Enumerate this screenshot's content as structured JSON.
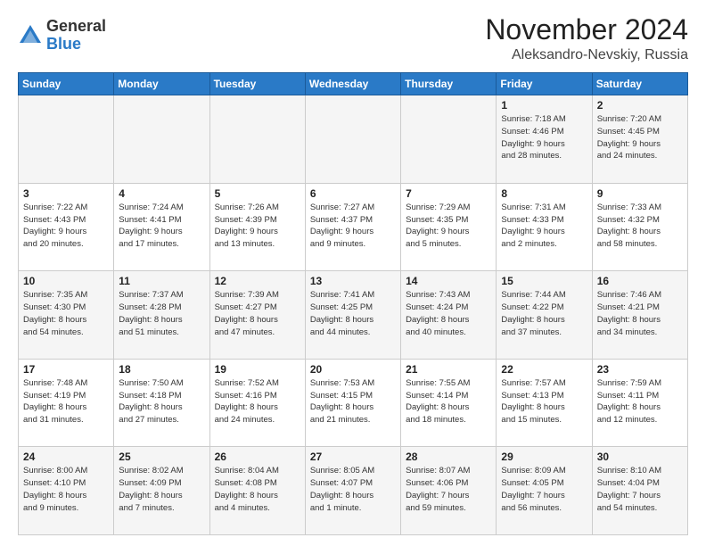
{
  "logo": {
    "general": "General",
    "blue": "Blue"
  },
  "title": "November 2024",
  "location": "Aleksandro-Nevskiy, Russia",
  "days_header": [
    "Sunday",
    "Monday",
    "Tuesday",
    "Wednesday",
    "Thursday",
    "Friday",
    "Saturday"
  ],
  "weeks": [
    [
      {
        "day": "",
        "info": ""
      },
      {
        "day": "",
        "info": ""
      },
      {
        "day": "",
        "info": ""
      },
      {
        "day": "",
        "info": ""
      },
      {
        "day": "",
        "info": ""
      },
      {
        "day": "1",
        "info": "Sunrise: 7:18 AM\nSunset: 4:46 PM\nDaylight: 9 hours\nand 28 minutes."
      },
      {
        "day": "2",
        "info": "Sunrise: 7:20 AM\nSunset: 4:45 PM\nDaylight: 9 hours\nand 24 minutes."
      }
    ],
    [
      {
        "day": "3",
        "info": "Sunrise: 7:22 AM\nSunset: 4:43 PM\nDaylight: 9 hours\nand 20 minutes."
      },
      {
        "day": "4",
        "info": "Sunrise: 7:24 AM\nSunset: 4:41 PM\nDaylight: 9 hours\nand 17 minutes."
      },
      {
        "day": "5",
        "info": "Sunrise: 7:26 AM\nSunset: 4:39 PM\nDaylight: 9 hours\nand 13 minutes."
      },
      {
        "day": "6",
        "info": "Sunrise: 7:27 AM\nSunset: 4:37 PM\nDaylight: 9 hours\nand 9 minutes."
      },
      {
        "day": "7",
        "info": "Sunrise: 7:29 AM\nSunset: 4:35 PM\nDaylight: 9 hours\nand 5 minutes."
      },
      {
        "day": "8",
        "info": "Sunrise: 7:31 AM\nSunset: 4:33 PM\nDaylight: 9 hours\nand 2 minutes."
      },
      {
        "day": "9",
        "info": "Sunrise: 7:33 AM\nSunset: 4:32 PM\nDaylight: 8 hours\nand 58 minutes."
      }
    ],
    [
      {
        "day": "10",
        "info": "Sunrise: 7:35 AM\nSunset: 4:30 PM\nDaylight: 8 hours\nand 54 minutes."
      },
      {
        "day": "11",
        "info": "Sunrise: 7:37 AM\nSunset: 4:28 PM\nDaylight: 8 hours\nand 51 minutes."
      },
      {
        "day": "12",
        "info": "Sunrise: 7:39 AM\nSunset: 4:27 PM\nDaylight: 8 hours\nand 47 minutes."
      },
      {
        "day": "13",
        "info": "Sunrise: 7:41 AM\nSunset: 4:25 PM\nDaylight: 8 hours\nand 44 minutes."
      },
      {
        "day": "14",
        "info": "Sunrise: 7:43 AM\nSunset: 4:24 PM\nDaylight: 8 hours\nand 40 minutes."
      },
      {
        "day": "15",
        "info": "Sunrise: 7:44 AM\nSunset: 4:22 PM\nDaylight: 8 hours\nand 37 minutes."
      },
      {
        "day": "16",
        "info": "Sunrise: 7:46 AM\nSunset: 4:21 PM\nDaylight: 8 hours\nand 34 minutes."
      }
    ],
    [
      {
        "day": "17",
        "info": "Sunrise: 7:48 AM\nSunset: 4:19 PM\nDaylight: 8 hours\nand 31 minutes."
      },
      {
        "day": "18",
        "info": "Sunrise: 7:50 AM\nSunset: 4:18 PM\nDaylight: 8 hours\nand 27 minutes."
      },
      {
        "day": "19",
        "info": "Sunrise: 7:52 AM\nSunset: 4:16 PM\nDaylight: 8 hours\nand 24 minutes."
      },
      {
        "day": "20",
        "info": "Sunrise: 7:53 AM\nSunset: 4:15 PM\nDaylight: 8 hours\nand 21 minutes."
      },
      {
        "day": "21",
        "info": "Sunrise: 7:55 AM\nSunset: 4:14 PM\nDaylight: 8 hours\nand 18 minutes."
      },
      {
        "day": "22",
        "info": "Sunrise: 7:57 AM\nSunset: 4:13 PM\nDaylight: 8 hours\nand 15 minutes."
      },
      {
        "day": "23",
        "info": "Sunrise: 7:59 AM\nSunset: 4:11 PM\nDaylight: 8 hours\nand 12 minutes."
      }
    ],
    [
      {
        "day": "24",
        "info": "Sunrise: 8:00 AM\nSunset: 4:10 PM\nDaylight: 8 hours\nand 9 minutes."
      },
      {
        "day": "25",
        "info": "Sunrise: 8:02 AM\nSunset: 4:09 PM\nDaylight: 8 hours\nand 7 minutes."
      },
      {
        "day": "26",
        "info": "Sunrise: 8:04 AM\nSunset: 4:08 PM\nDaylight: 8 hours\nand 4 minutes."
      },
      {
        "day": "27",
        "info": "Sunrise: 8:05 AM\nSunset: 4:07 PM\nDaylight: 8 hours\nand 1 minute."
      },
      {
        "day": "28",
        "info": "Sunrise: 8:07 AM\nSunset: 4:06 PM\nDaylight: 7 hours\nand 59 minutes."
      },
      {
        "day": "29",
        "info": "Sunrise: 8:09 AM\nSunset: 4:05 PM\nDaylight: 7 hours\nand 56 minutes."
      },
      {
        "day": "30",
        "info": "Sunrise: 8:10 AM\nSunset: 4:04 PM\nDaylight: 7 hours\nand 54 minutes."
      }
    ]
  ]
}
